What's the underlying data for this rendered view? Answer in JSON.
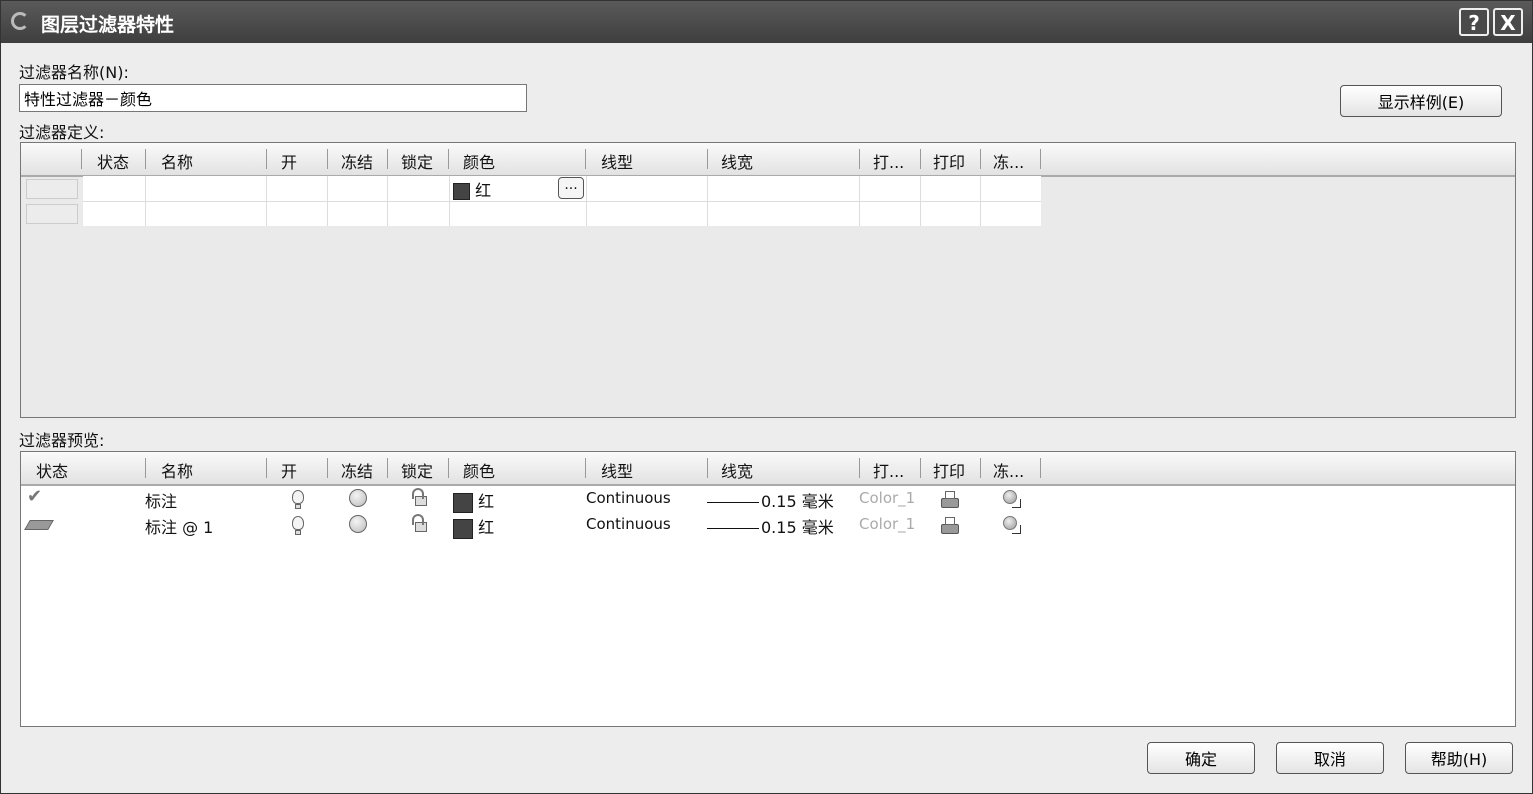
{
  "window": {
    "title": "图层过滤器特性",
    "help_btn": "?",
    "close_btn": "X"
  },
  "filter_name": {
    "label": "过滤器名称(N):",
    "value": "特性过滤器－颜色"
  },
  "show_example_btn": "显示样例(E)",
  "definition": {
    "label": "过滤器定义:",
    "columns": [
      "状态",
      "名称",
      "开",
      "冻结",
      "锁定",
      "颜色",
      "线型",
      "线宽",
      "打...",
      "打印",
      "冻..."
    ],
    "rows": [
      {
        "color": "红",
        "ellipsis": "..."
      }
    ]
  },
  "preview": {
    "label": "过滤器预览:",
    "columns": [
      "状态",
      "名称",
      "开",
      "冻结",
      "锁定",
      "颜色",
      "线型",
      "线宽",
      "打...",
      "打印",
      "冻..."
    ],
    "rows": [
      {
        "status": "check-icon",
        "name": "标注",
        "on": "bulb-icon",
        "freeze": "sun-icon",
        "lock": "lock-icon",
        "color": "红",
        "linetype": "Continuous",
        "lineweight": "0.15 毫米",
        "plotstyle": "Color_1",
        "plot": "printer-icon",
        "vpfreeze": "vp-freeze-icon"
      },
      {
        "status": "layer-stack-icon",
        "name": "标注 @ 1",
        "on": "bulb-icon",
        "freeze": "sun-icon",
        "lock": "lock-icon",
        "color": "红",
        "linetype": "Continuous",
        "lineweight": "0.15 毫米",
        "plotstyle": "Color_1",
        "plot": "printer-icon",
        "vpfreeze": "vp-freeze-icon"
      }
    ]
  },
  "buttons": {
    "ok": "确定",
    "cancel": "取消",
    "help": "帮助(H)"
  },
  "colors": {
    "titlebar": "#4a4a4a",
    "swatch_red_shown_as": "#444444"
  }
}
